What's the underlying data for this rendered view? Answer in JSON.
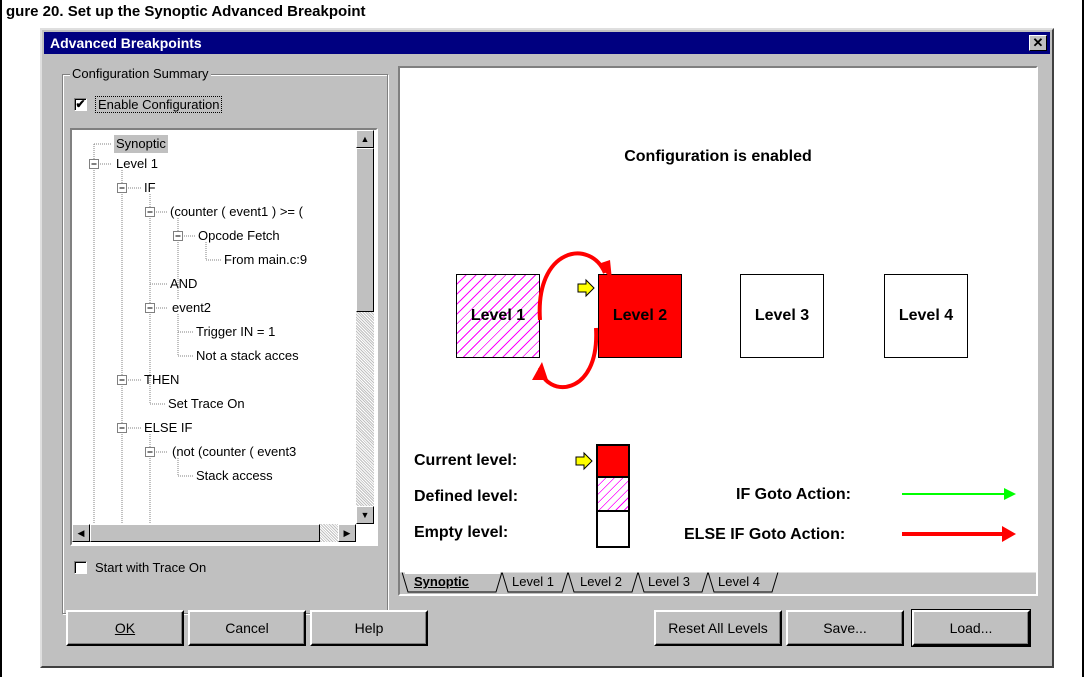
{
  "caption": "gure 20. Set up the Synoptic Advanced Breakpoint",
  "window": {
    "title": "Advanced Breakpoints",
    "close_glyph": "✕"
  },
  "summary": {
    "group_label": "Configuration Summary",
    "enable_label": "Enable Configuration",
    "enable_checked": true,
    "start_trace_label": "Start with Trace On",
    "start_trace_checked": false
  },
  "tree": [
    {
      "label": "Synoptic",
      "selected": true
    },
    {
      "label": "Level 1"
    },
    {
      "label": "IF"
    },
    {
      "label": "(counter ( event1 ) >= ("
    },
    {
      "label": "Opcode Fetch"
    },
    {
      "label": "From main.c:9"
    },
    {
      "label": "AND"
    },
    {
      "label": "event2"
    },
    {
      "label": "Trigger IN = 1"
    },
    {
      "label": "Not a stack acces"
    },
    {
      "label": "THEN"
    },
    {
      "label": "Set Trace On"
    },
    {
      "label": "ELSE IF"
    },
    {
      "label": "(not (counter ( event3"
    },
    {
      "label": "Stack access"
    }
  ],
  "synoptic": {
    "status": "Configuration is enabled",
    "levels": [
      {
        "label": "Level 1",
        "state": "defined"
      },
      {
        "label": "Level 2",
        "state": "current"
      },
      {
        "label": "Level 3",
        "state": "empty"
      },
      {
        "label": "Level 4",
        "state": "empty"
      }
    ],
    "legend": {
      "current": "Current level:",
      "defined": "Defined level:",
      "empty": "Empty level:",
      "if_goto": "IF Goto Action:",
      "else_goto": "ELSE IF Goto Action:"
    },
    "colors": {
      "current": "#ff0000",
      "defined_hatch": "#ff00ff",
      "if_arrow": "#00ff00",
      "else_arrow": "#ff0000",
      "marker": "#ffff00"
    },
    "tabs": [
      "Synoptic",
      "Level 1",
      "Level 2",
      "Level 3",
      "Level 4"
    ],
    "active_tab": "Synoptic"
  },
  "buttons": {
    "ok": "OK",
    "cancel": "Cancel",
    "help": "Help",
    "reset": "Reset All Levels",
    "save": "Save...",
    "load": "Load..."
  }
}
